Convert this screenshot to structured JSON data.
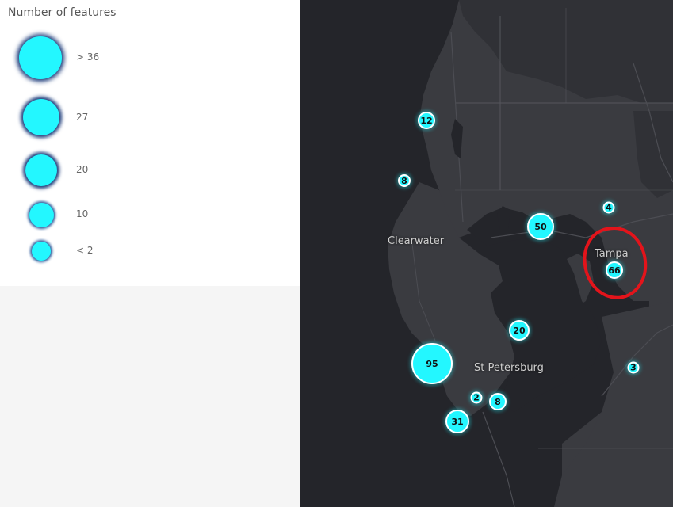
{
  "legend": {
    "title": "Number of features",
    "items": [
      {
        "label": "> 36"
      },
      {
        "label": "27"
      },
      {
        "label": "20"
      },
      {
        "label": "10"
      },
      {
        "label": "< 2"
      }
    ]
  },
  "map": {
    "places": [
      {
        "name": "Clearwater"
      },
      {
        "name": "Tampa"
      },
      {
        "name": "St Petersburg"
      }
    ],
    "clusters": [
      {
        "count": "12"
      },
      {
        "count": "8"
      },
      {
        "count": "50"
      },
      {
        "count": "4"
      },
      {
        "count": "66"
      },
      {
        "count": "20"
      },
      {
        "count": "95"
      },
      {
        "count": "2"
      },
      {
        "count": "8"
      },
      {
        "count": "31"
      },
      {
        "count": "3"
      }
    ],
    "colors": {
      "water": "#24252a",
      "land": "#3a3b40",
      "cluster": "#23f7ff",
      "highlight": "#e3141b"
    }
  }
}
